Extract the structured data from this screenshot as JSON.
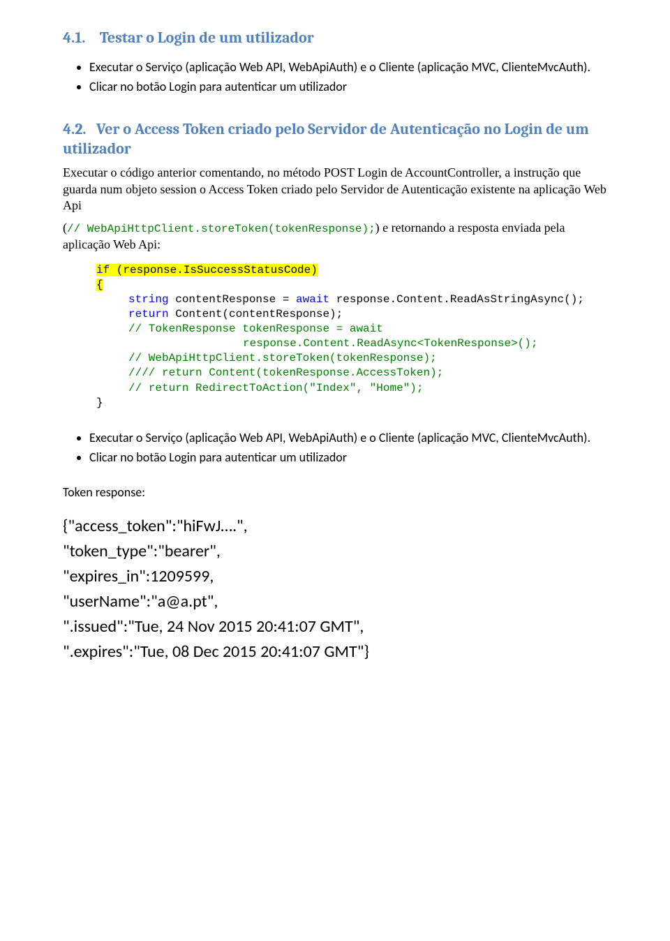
{
  "section1": {
    "number": "4.1.",
    "title": "Testar o Login de um utilizador",
    "bullets": [
      "Executar o Serviço (aplicação Web API, WebApiAuth) e o Cliente (aplicação MVC, ClienteMvcAuth).",
      "Clicar no botão Login para autenticar um utilizador"
    ]
  },
  "section2": {
    "number": "4.2.",
    "title": "Ver o Access Token criado pelo Servidor de Autenticação no Login de um utilizador",
    "para1": "Executar o código anterior comentando, no método POST Login de AccountController,  a instrução que guarda num objeto session o Access Token criado pelo Servidor de Autenticação existente na aplicação Web Api",
    "inlineCodePrefix": "(",
    "inlineCodeComment": "//     WebApiHttpClient.storeToken(tokenResponse);",
    "inlineCodeSuffix": ") e retornando a resposta enviada pela aplicação Web Api:"
  },
  "code": {
    "ifLine": {
      "kw": "if",
      "rest": " (response.IsSuccessStatusCode)"
    },
    "openBrace": "{",
    "l1": {
      "kw": "string",
      "rest": " contentResponse = ",
      "kw2": "await",
      "rest2": " response.Content.ReadAsStringAsync();"
    },
    "l2": {
      "kw": "return",
      "rest": " Content(contentResponse);"
    },
    "l3": "// TokenResponse tokenResponse = await",
    "l3b": "response.Content.ReadAsync<TokenResponse>();",
    "l4": "// WebApiHttpClient.storeToken(tokenResponse);",
    "l5": "//// return Content(tokenResponse.AccessToken);",
    "l6": "// return RedirectToAction(\"Index\", \"Home\");",
    "closeBrace": "}"
  },
  "section2b": {
    "bullets": [
      "Executar o Serviço (aplicação Web API, WebApiAuth) e o Cliente (aplicação MVC, ClienteMvcAuth).",
      "Clicar no botão Login para autenticar um utilizador"
    ],
    "tokenResponseLabel": "Token response:"
  },
  "tokenJson": {
    "l1": "{\"access_token\":\"hiFwJ….\",",
    "l2": "\"token_type\":\"bearer\",",
    "l3": "\"expires_in\":1209599,",
    "l4": "\"userName\":\"a@a.pt\",",
    "l5": "\".issued\":\"Tue, 24 Nov 2015 20:41:07 GMT\",",
    "l6": "\".expires\":\"Tue, 08 Dec 2015 20:41:07 GMT\"}"
  }
}
